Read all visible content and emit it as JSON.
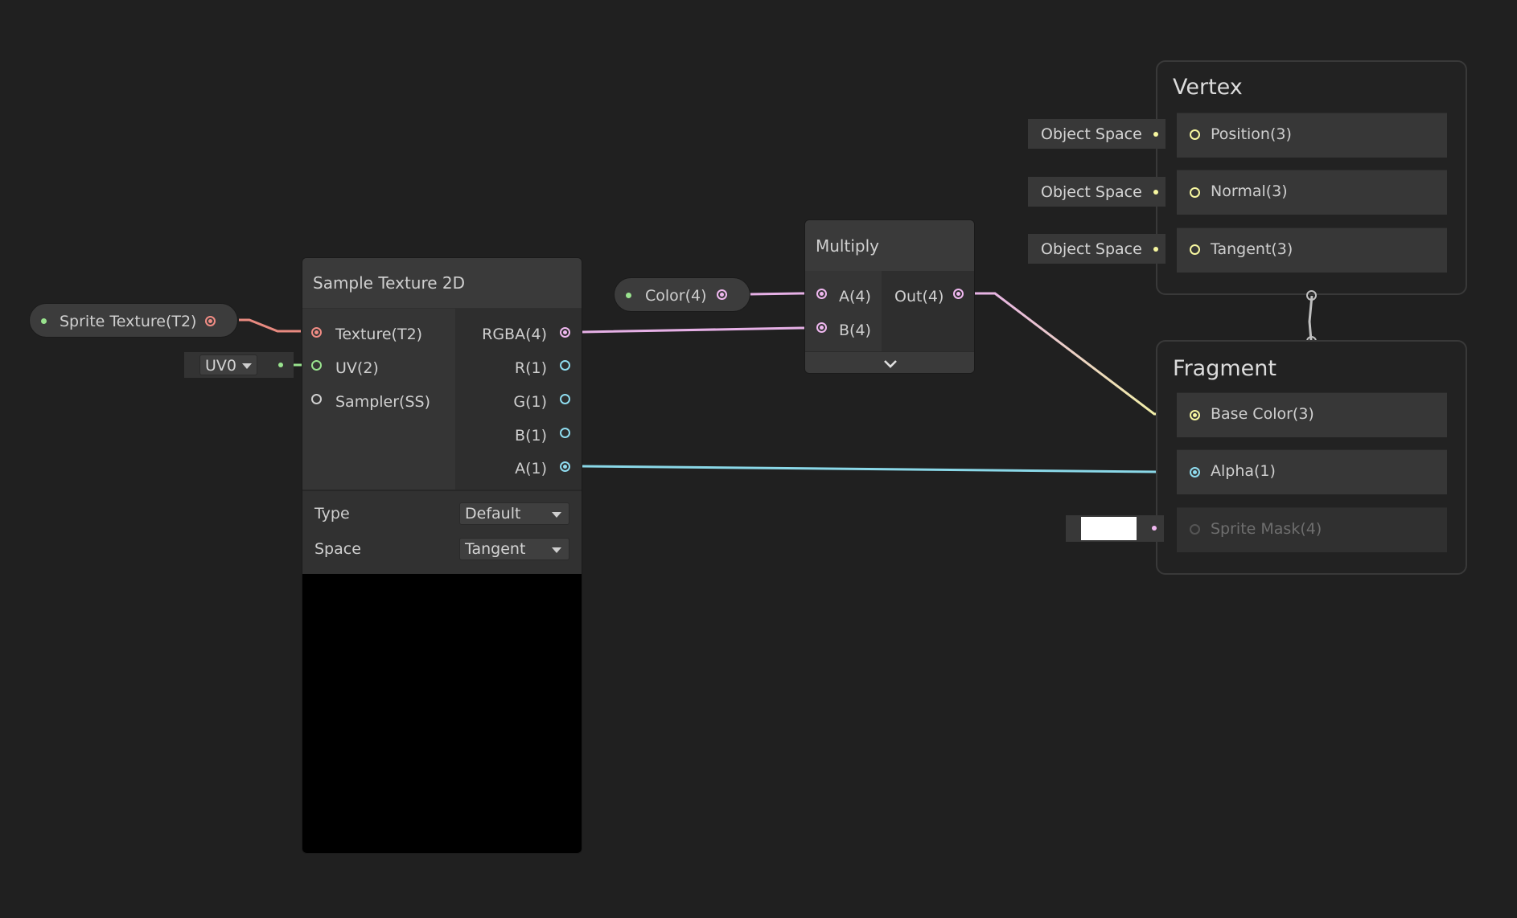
{
  "colors": {
    "texture": "#f08c84",
    "vector2": "#99e38e",
    "vector3": "#f7f7a0",
    "vector4": "#f0b8f0",
    "float": "#8fdcef",
    "sampler": "#cfcfcf",
    "wire_yellow": "#f2f2a4",
    "wire_pink": "#e6b0e6",
    "wire_cyan": "#8ad8e8",
    "wire_red": "#e88a80"
  },
  "property_nodes": {
    "sprite_texture": "Sprite Texture(T2)",
    "color": "Color(4)"
  },
  "uv_dropdown": "UV0",
  "sample_texture": {
    "title": "Sample Texture 2D",
    "inputs": [
      "Texture(T2)",
      "UV(2)",
      "Sampler(SS)"
    ],
    "outputs": [
      "RGBA(4)",
      "R(1)",
      "G(1)",
      "B(1)",
      "A(1)"
    ],
    "type_label": "Type",
    "type_value": "Default",
    "space_label": "Space",
    "space_value": "Tangent"
  },
  "multiply": {
    "title": "Multiply",
    "inputs": [
      "A(4)",
      "B(4)"
    ],
    "output": "Out(4)",
    "expand_icon": "chevron-down-icon"
  },
  "vertex": {
    "title": "Vertex",
    "blocks": [
      "Position(3)",
      "Normal(3)",
      "Tangent(3)"
    ],
    "space_tags": [
      "Object Space",
      "Object Space",
      "Object Space"
    ]
  },
  "fragment": {
    "title": "Fragment",
    "blocks": [
      "Base Color(3)",
      "Alpha(1)",
      "Sprite Mask(4)"
    ]
  }
}
